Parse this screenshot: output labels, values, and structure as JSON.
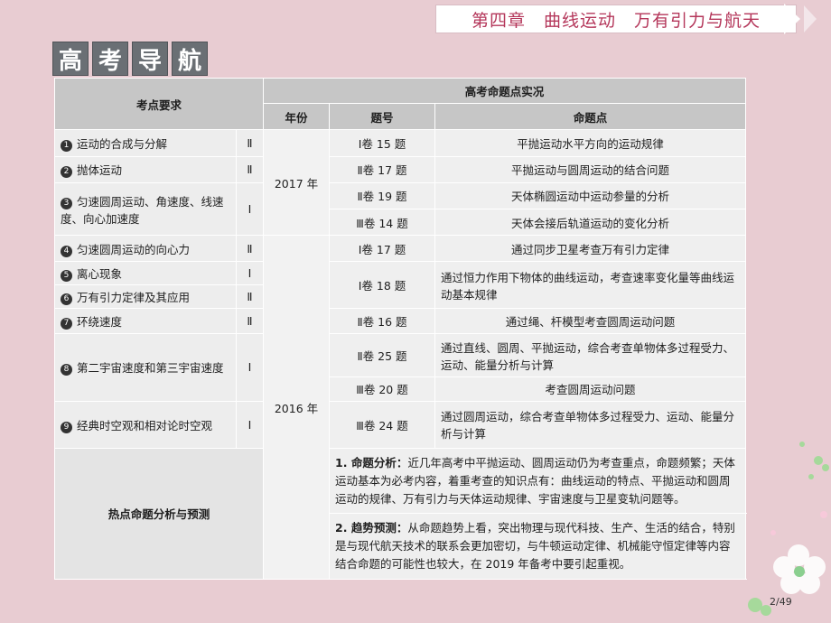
{
  "header": {
    "chapter": "第四章　曲线运动　万有引力与航天"
  },
  "title": [
    "高",
    "考",
    "导",
    "航"
  ],
  "table": {
    "col_points": "考点要求",
    "col_exam": "高考命题点实况",
    "col_year": "年份",
    "col_no": "题号",
    "col_topic": "命题点",
    "points": [
      {
        "num": "1",
        "text": "运动的合成与分解",
        "level": "Ⅱ"
      },
      {
        "num": "2",
        "text": "抛体运动",
        "level": "Ⅱ"
      },
      {
        "num": "3",
        "text": "匀速圆周运动、角速度、线速度、向心加速度",
        "level": "Ⅰ"
      },
      {
        "num": "4",
        "text": "匀速圆周运动的向心力",
        "level": "Ⅱ"
      },
      {
        "num": "5",
        "text": "离心现象",
        "level": "Ⅰ"
      },
      {
        "num": "6",
        "text": "万有引力定律及其应用",
        "level": "Ⅱ"
      },
      {
        "num": "7",
        "text": "环绕速度",
        "level": "Ⅱ"
      },
      {
        "num": "8",
        "text": "第二宇宙速度和第三宇宙速度",
        "level": "Ⅰ"
      },
      {
        "num": "9",
        "text": "经典时空观和相对论时空观",
        "level": "Ⅰ"
      }
    ],
    "years": [
      "2017 年",
      "2016 年"
    ],
    "exams": [
      {
        "no": "Ⅰ卷 15 题",
        "topic": "平抛运动水平方向的运动规律"
      },
      {
        "no": "Ⅱ卷 17 题",
        "topic": "平抛运动与圆周运动的结合问题"
      },
      {
        "no": "Ⅱ卷 19 题",
        "topic": "天体椭圆运动中运动参量的分析"
      },
      {
        "no": "Ⅲ卷 14 题",
        "topic": "天体会接后轨道运动的变化分析"
      },
      {
        "no": "Ⅰ卷 17 题",
        "topic": "通过同步卫星考查万有引力定律"
      },
      {
        "no": "Ⅰ卷 18 题",
        "topic": "通过恒力作用下物体的曲线运动，考查速率变化量等曲线运动基本规律"
      },
      {
        "no": "Ⅱ卷 16 题",
        "topic": "通过绳、杆模型考查圆周运动问题"
      },
      {
        "no": "Ⅱ卷 25 题",
        "topic": "通过直线、圆周、平抛运动，综合考查单物体多过程受力、运动、能量分析与计算"
      },
      {
        "no": "Ⅲ卷 20 题",
        "topic": "考查圆周运动问题"
      },
      {
        "no": "Ⅲ卷 24 题",
        "topic": "通过圆周运动，综合考查单物体多过程受力、运动、能量分析与计算"
      }
    ],
    "analysis_label": "热点命题分析与预测",
    "analysis1_head": "1. 命题分析：",
    "analysis1_body": "近几年高考中平抛运动、圆周运动仍为考查重点，命题频繁；天体运动基本为必考内容，着重考查的知识点有：曲线运动的特点、平抛运动和圆周运动的规律、万有引力与天体运动规律、宇宙速度与卫星变轨问题等。",
    "analysis2_head": "2. 趋势预测：",
    "analysis2_body": "从命题趋势上看，突出物理与现代科技、生产、生活的结合，特别是与现代航天技术的联系会更加密切，与牛顿运动定律、机械能守恒定律等内容结合命题的可能性也较大，在 2019 年备考中要引起重视。"
  },
  "page_number": "2/49"
}
